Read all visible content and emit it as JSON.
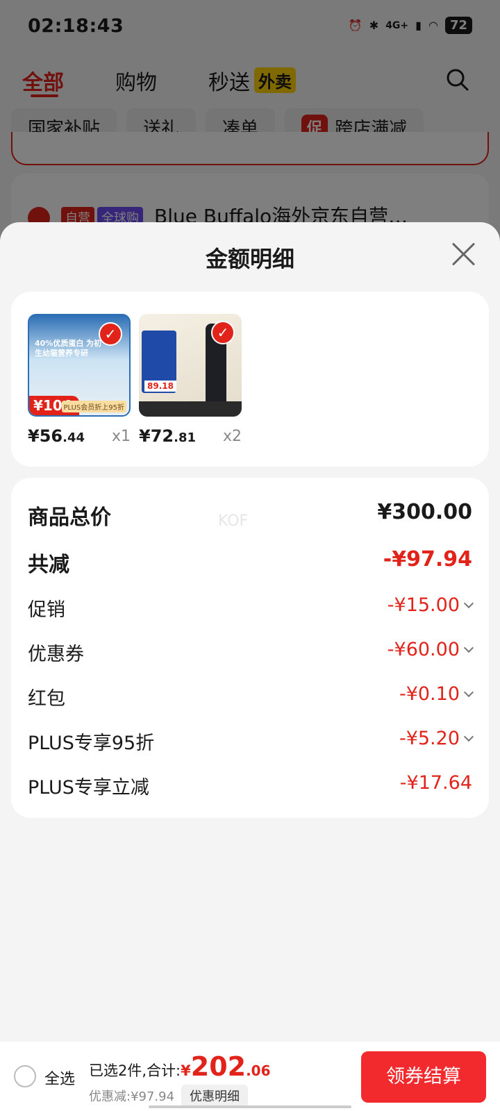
{
  "status_bar": {
    "time": "02:18:43",
    "battery": "72",
    "network": "4G+"
  },
  "top_tabs": {
    "all": "全部",
    "shopping": "购物",
    "flash": "秒送",
    "flash_tag": "外卖"
  },
  "filter_chips": {
    "subsidy": "国家补贴",
    "gift": "送礼",
    "combine": "凑单",
    "promo_badge": "促",
    "cross_store": "跨店满减"
  },
  "background_store": {
    "tag_self": "自营",
    "tag_global": "全球购",
    "name": "Blue Buffalo海外京东自营…"
  },
  "sheet": {
    "title": "金额明细",
    "watermark": "KOF"
  },
  "products": [
    {
      "thumb_title": "40%优质蛋白 为初生幼猫营养专研",
      "badge": "¥104",
      "plus_tag": "PLUS会员折上95折",
      "price_int": "¥56",
      "price_dec": ".44",
      "qty": "x1"
    },
    {
      "thumb_price": "89.18",
      "price_int": "¥72",
      "price_dec": ".81",
      "qty": "x2"
    }
  ],
  "details": {
    "total_label": "商品总价",
    "total_value": "¥300.00",
    "reduce_label": "共减",
    "reduce_value": "-¥97.94",
    "promo_label": "促销",
    "promo_value": "-¥15.00",
    "coupon_label": "优惠券",
    "coupon_value": "-¥60.00",
    "redpack_label": "红包",
    "redpack_value": "-¥0.10",
    "plus95_label": "PLUS专享95折",
    "plus95_value": "-¥5.20",
    "plusreduce_label": "PLUS专享立减",
    "plusreduce_value": "-¥17.64"
  },
  "bottom_bar": {
    "select_all": "全选",
    "selected_text": "已选2件,合计:",
    "total_yen": "¥",
    "total_int": "202",
    "total_dec": ".06",
    "discount_text": "优惠减:¥97.94",
    "detail_link": "优惠明细",
    "checkout": "领券结算"
  },
  "colors": {
    "accent": "#e2231a",
    "checkout": "#f22a2e"
  }
}
